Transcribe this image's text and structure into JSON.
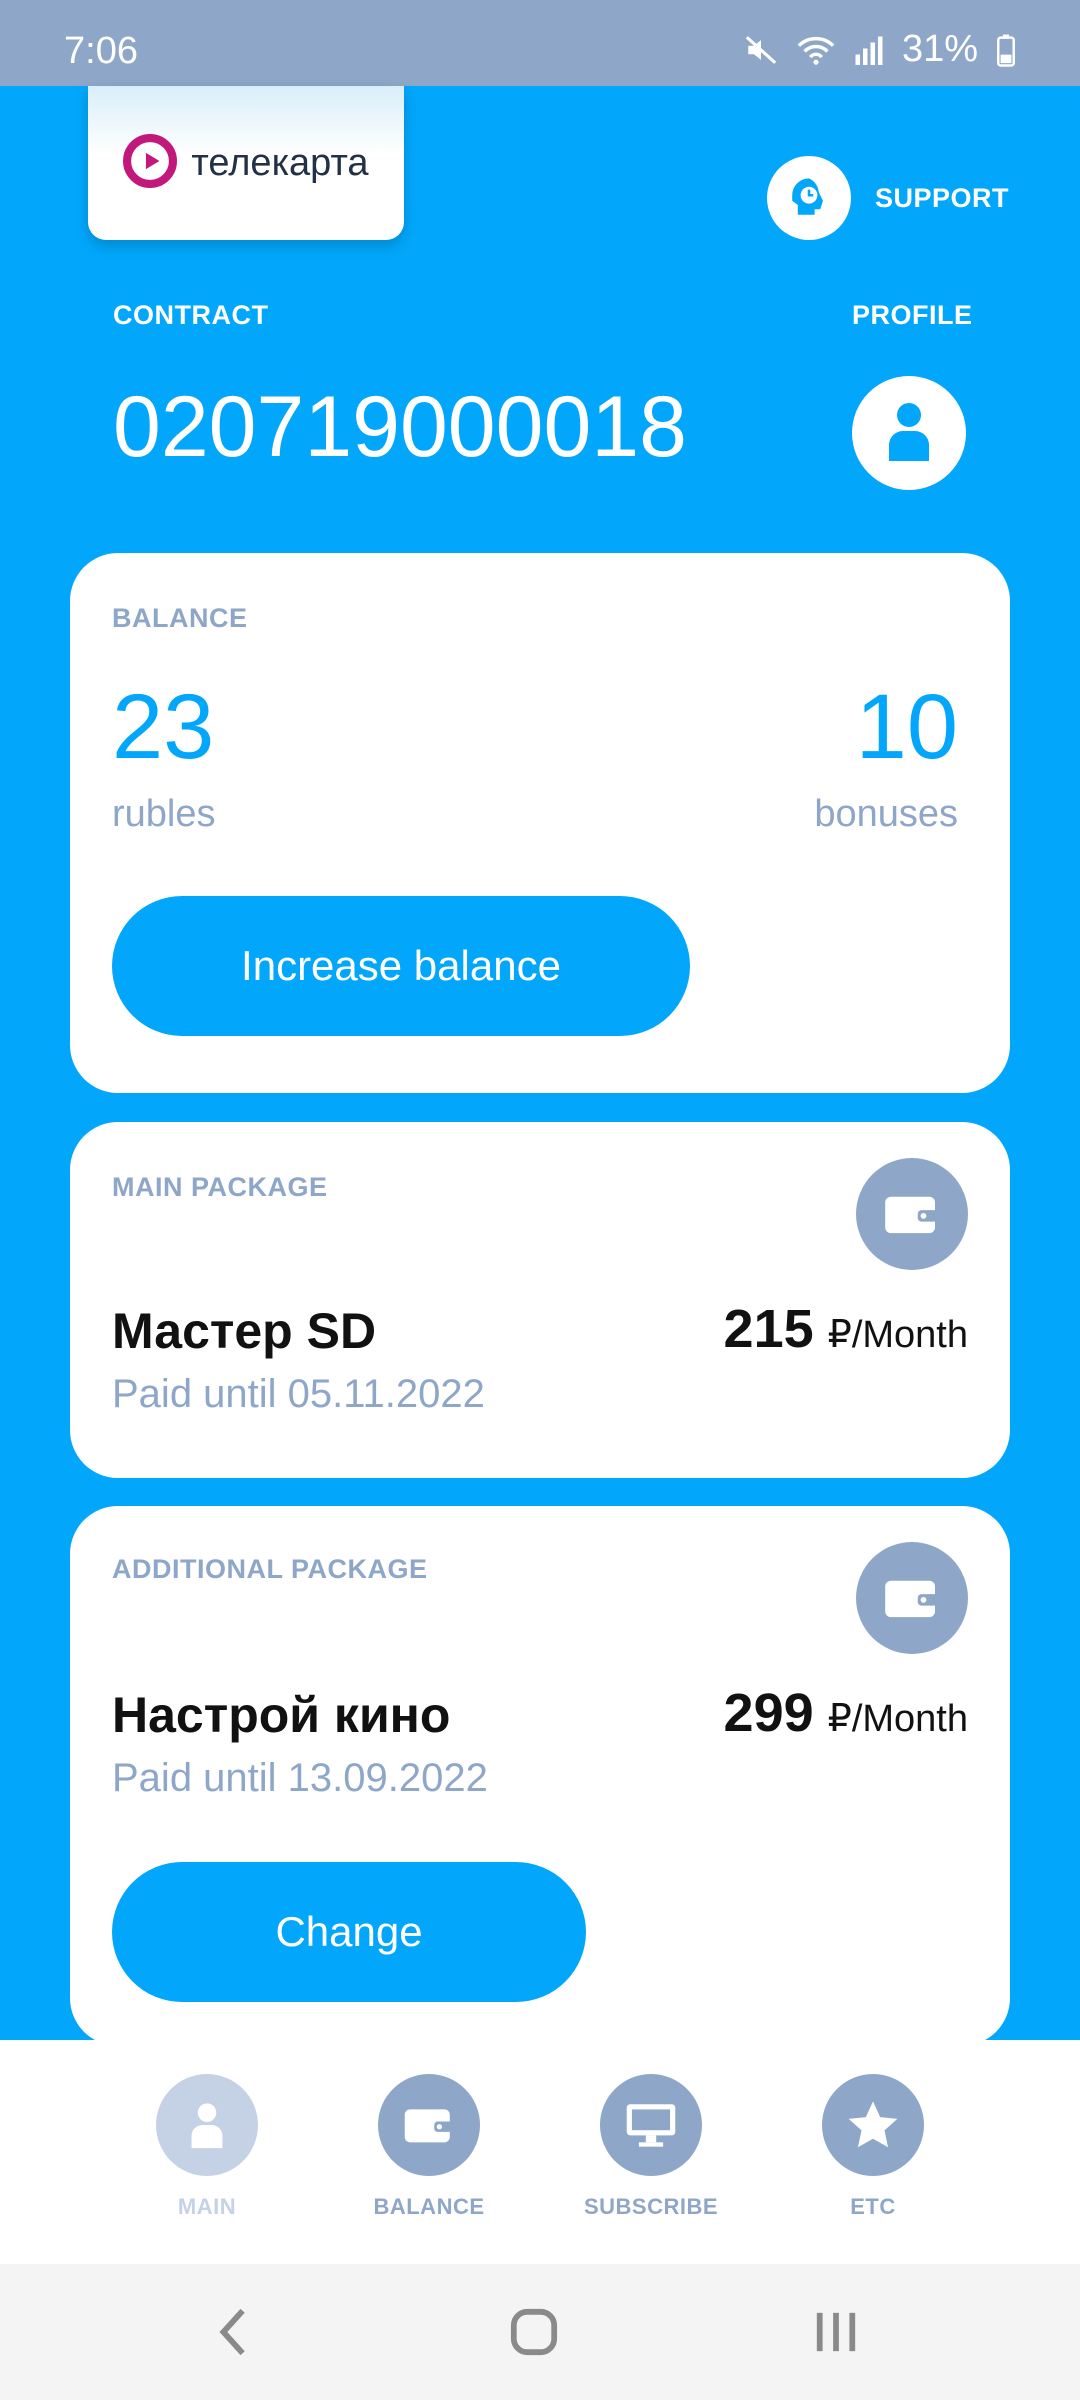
{
  "status_bar": {
    "time": "7:06",
    "battery": "31%"
  },
  "brand": {
    "logo_text": "телекарта",
    "logo_color": "#c2187b"
  },
  "header": {
    "support_label": "SUPPORT",
    "contract_label": "CONTRACT",
    "profile_label": "PROFILE",
    "contract_number": "020719000018"
  },
  "balance": {
    "label": "BALANCE",
    "rubles_value": "23",
    "rubles_unit": "rubles",
    "bonuses_value": "10",
    "bonuses_unit": "bonuses",
    "increase_button": "Increase balance"
  },
  "main_package": {
    "label": "MAIN PACKAGE",
    "name": "Мастер SD",
    "paid_until": "Paid until 05.11.2022",
    "price": "215",
    "price_unit": "₽/Month"
  },
  "additional_package": {
    "label": "ADDITIONAL PACKAGE",
    "name": "Настрой кино",
    "paid_until": "Paid until 13.09.2022",
    "price": "299",
    "price_unit": "₽/Month",
    "change_button": "Change"
  },
  "bottom_nav": {
    "items": [
      {
        "label": "MAIN",
        "icon": "user-icon",
        "active": true
      },
      {
        "label": "BALANCE",
        "icon": "wallet-icon",
        "active": false
      },
      {
        "label": "SUBSCRIBE",
        "icon": "monitor-icon",
        "active": false
      },
      {
        "label": "ETC",
        "icon": "star-icon",
        "active": false
      }
    ]
  },
  "colors": {
    "accent": "#02a7fb",
    "muted": "#8ea6c8",
    "status_bar": "#8ea6c8"
  }
}
